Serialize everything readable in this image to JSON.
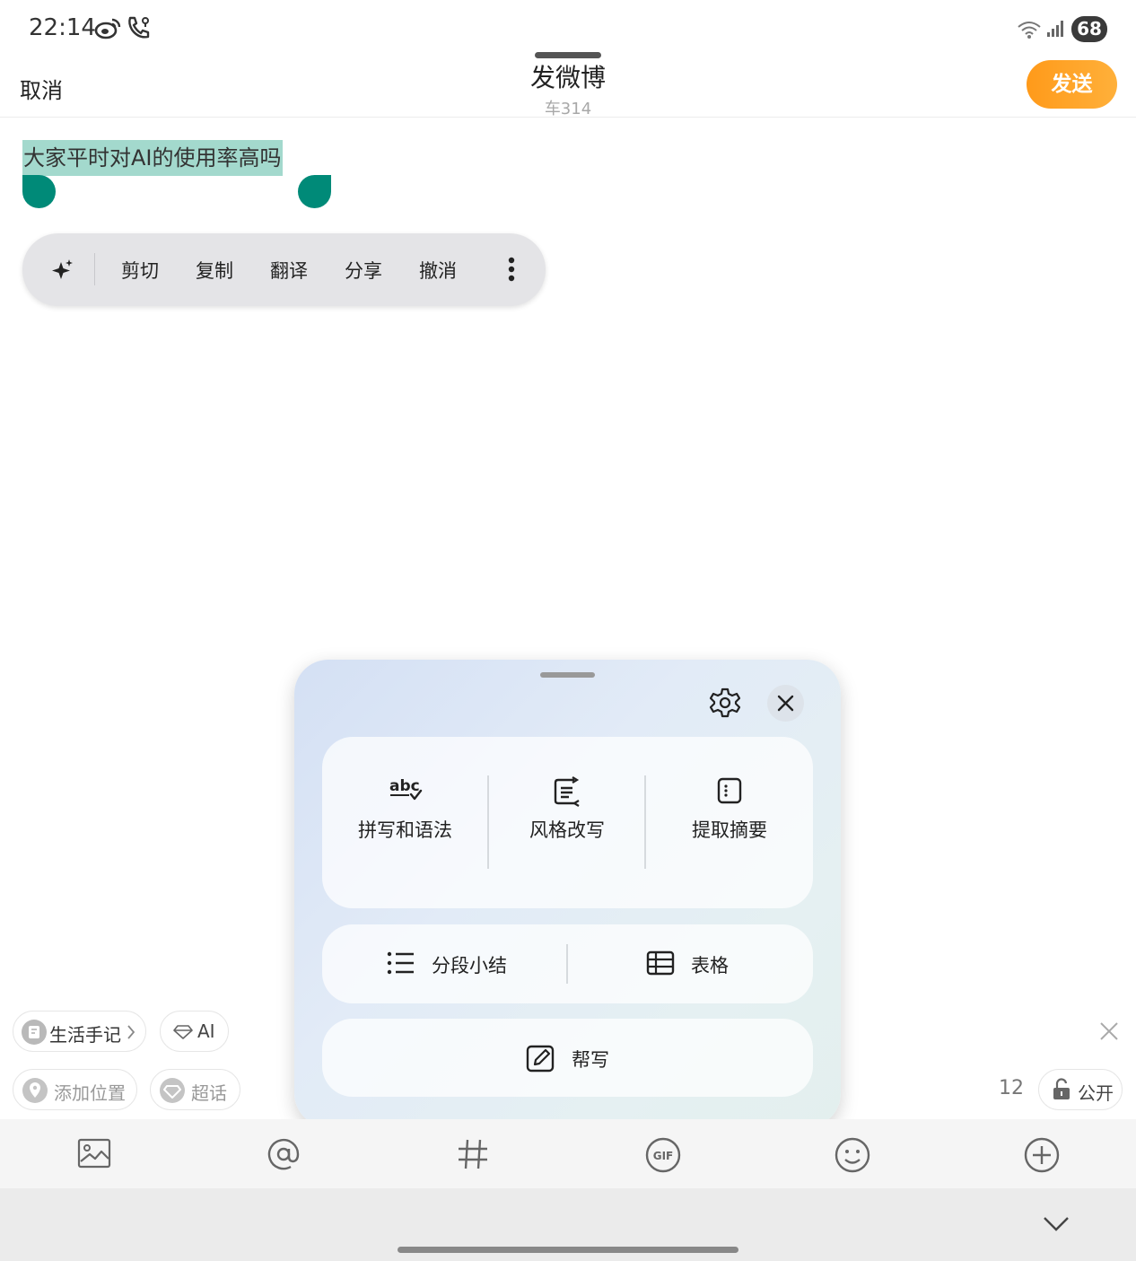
{
  "status_bar": {
    "time": "22:14",
    "battery": "68"
  },
  "header": {
    "cancel": "取消",
    "title": "发微博",
    "subtitle": "车314",
    "send": "发送"
  },
  "editor": {
    "text": "大家平时对AI的使用率高吗"
  },
  "context_menu": {
    "items": [
      "剪切",
      "复制",
      "翻译",
      "分享",
      "撤消"
    ]
  },
  "ai_panel": {
    "tools": [
      "拼写和语法",
      "风格改写",
      "提取摘要"
    ],
    "abc_glyph": "abc",
    "row": [
      "分段小结",
      "表格"
    ],
    "help_write": "帮写"
  },
  "chips": {
    "life_notes": "生活手记",
    "ai": "AI",
    "location": "添加位置",
    "topic": "超话",
    "visibility": "公开",
    "char_count": "12"
  },
  "toolbar": {
    "gif": "GIF"
  },
  "colors": {
    "accent": "#ff9a1a",
    "selection": "#a3d9cd",
    "handle": "#008a78"
  }
}
